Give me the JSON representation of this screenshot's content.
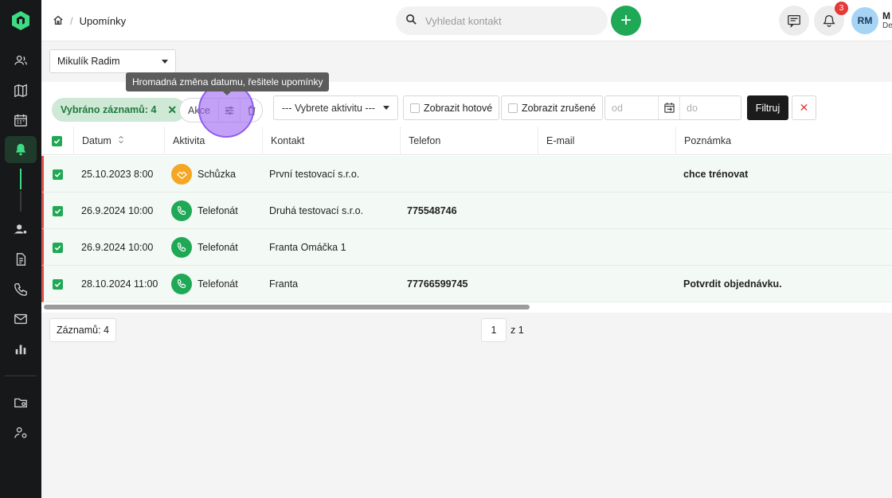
{
  "topbar": {
    "breadcrumb_current": "Upomínky",
    "search_placeholder": "Vyhledat kontakt",
    "add_label": "+",
    "notifications_count": "3",
    "avatar_initials": "RM",
    "user_name": "M",
    "user_sub": "De"
  },
  "resolver_select": {
    "value": "Mikulík Radim"
  },
  "tooltip": "Hromadná změna datumu, řešitele upomínky",
  "toolbar": {
    "selected_chip": "Vybráno záznamů: 4",
    "chip_close": "✕",
    "actions_label": "Akce",
    "activity_select": "--- Vybrete aktivitu ---",
    "show_done": "Zobrazit hotové",
    "show_cancelled": "Zobrazit zrušené",
    "date_from_placeholder": "od",
    "date_to_placeholder": "do",
    "filter_button": "Filtruj",
    "clear_button": "✕"
  },
  "table": {
    "columns": [
      "Datum",
      "Aktivita",
      "Kontakt",
      "Telefon",
      "E-mail",
      "Poznámka"
    ],
    "rows": [
      {
        "date": "25.10.2023 8:00",
        "activity": "Schůzka",
        "activity_icon": "handshake-icon",
        "contact": "První testovací s.r.o.",
        "phone": "",
        "email": "",
        "note": "chce trénovat"
      },
      {
        "date": "26.9.2024 10:00",
        "activity": "Telefonát",
        "activity_icon": "phone-icon",
        "contact": "Druhá testovací s.r.o.",
        "phone": "775548746",
        "email": "",
        "note": ""
      },
      {
        "date": "26.9.2024 10:00",
        "activity": "Telefonát",
        "activity_icon": "phone-icon",
        "contact": "Franta Omáčka 1",
        "phone": "",
        "email": "",
        "note": ""
      },
      {
        "date": "28.10.2024 11:00",
        "activity": "Telefonát",
        "activity_icon": "phone-icon",
        "contact": "Franta",
        "phone": "77766599745",
        "email": "",
        "note": "Potvrdit objednávku."
      }
    ]
  },
  "footer": {
    "records": "Záznamů: 4",
    "page": "1",
    "page_of": "z 1"
  },
  "colors": {
    "accent": "#1fa855",
    "sidebar": "#17181a",
    "highlight": "#9d68f2",
    "meeting": "#f5a623"
  }
}
